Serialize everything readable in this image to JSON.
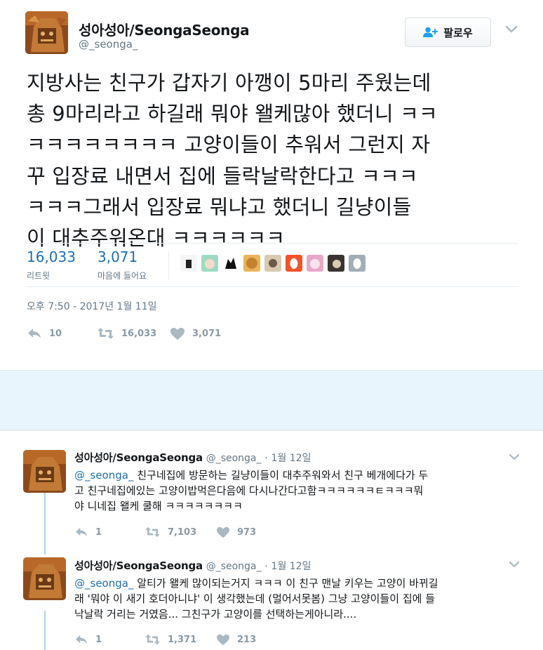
{
  "main_tweet": {
    "display_name": "성아성아/SeongaSeonga",
    "handle": "@_seonga_",
    "follow_label": "팔로우",
    "text_lines": [
      "지방사는 친구가 갑자기 아깽이 5마리 주웠는데",
      "총 9마리라고 하길래 뭐야 왤케많아 했더니 ㅋㅋ",
      "ㅋㅋㅋㅋㅋㅋㅋㅋ 고양이들이 추워서 그런지 자",
      "꾸 입장료 내면서 집에 들락날락한다고 ㅋㅋㅋ",
      "ㅋㅋㅋ그래서 입장료 뭐냐고 했더니 길냥이들",
      "이 대추주워온대 ㅋㅋㅋㅋㅋㅋ"
    ],
    "retweets_count": "16,033",
    "retweets_label": "리트윗",
    "likes_count": "3,071",
    "likes_label": "마음에 들어요",
    "timestamp": "오후 7:50 - 2017년 1월 11일",
    "action_reply_count": "10",
    "action_retweet_count": "16,033",
    "action_like_count": "3,071"
  },
  "likers": [
    {
      "icon": "liker-avatar-1",
      "bg": "#f5f5f5"
    },
    {
      "icon": "liker-avatar-2",
      "bg": "#9fd9c4"
    },
    {
      "icon": "liker-avatar-3",
      "bg": "#ffffff"
    },
    {
      "icon": "liker-avatar-4",
      "bg": "#e9b45a"
    },
    {
      "icon": "liker-avatar-5",
      "bg": "#d9c9b0"
    },
    {
      "icon": "liker-default-egg-orange",
      "bg": "#f0542a"
    },
    {
      "icon": "liker-avatar-7",
      "bg": "#e7a8c8"
    },
    {
      "icon": "liker-avatar-8",
      "bg": "#3a3530"
    },
    {
      "icon": "liker-default-egg-gray",
      "bg": "#a4adb5"
    }
  ],
  "replies": [
    {
      "display_name": "성아성아/SeongaSeonga",
      "handle": "@_seonga_",
      "dot": "·",
      "date": "1월 12일",
      "mention": "@_seonga_",
      "line1_rest": " 친구네집에 방문하는 길냥이들이 대추주워와서 친구 베개에다가 두",
      "line2": "고 친구네집에있는 고양이밥먹은다음에 다시나간다고함ㅋㅋㅋㅋㅋㅋㅌㅋㅋㅋ뭐",
      "line3": "야 니네집 왤케 쿨해 ㅋㅋㅋㅋㅋㅋㅋㅋ",
      "reply_count": "1",
      "retweet_count": "7,103",
      "like_count": "973"
    },
    {
      "display_name": "성아성아/SeongaSeonga",
      "handle": "@_seonga_",
      "dot": "·",
      "date": "1월 12일",
      "mention": "@_seonga_",
      "line1_rest": " 알티가 왤케 많이되는거지 ㅋㅋㅋ 이 친구 맨날 키우는 고양이 바뀌길",
      "line2": "래 '뭐야 이 새기 호더아니냐' 이 생각했는데 (멀어서못봄) 그냥 고양이들이 집에 들",
      "line3": "낙날락 거리는 거였음... 그친구가 고양이를 선택하는게아니라....",
      "reply_count": "1",
      "retweet_count": "1,371",
      "like_count": "213"
    }
  ],
  "colors": {
    "link_blue": "#1b6fb3",
    "muted_gray": "#657786",
    "action_gray": "#8899a6",
    "band_blue": "#e8f5fd",
    "thread_line": "#a6d4f2"
  }
}
